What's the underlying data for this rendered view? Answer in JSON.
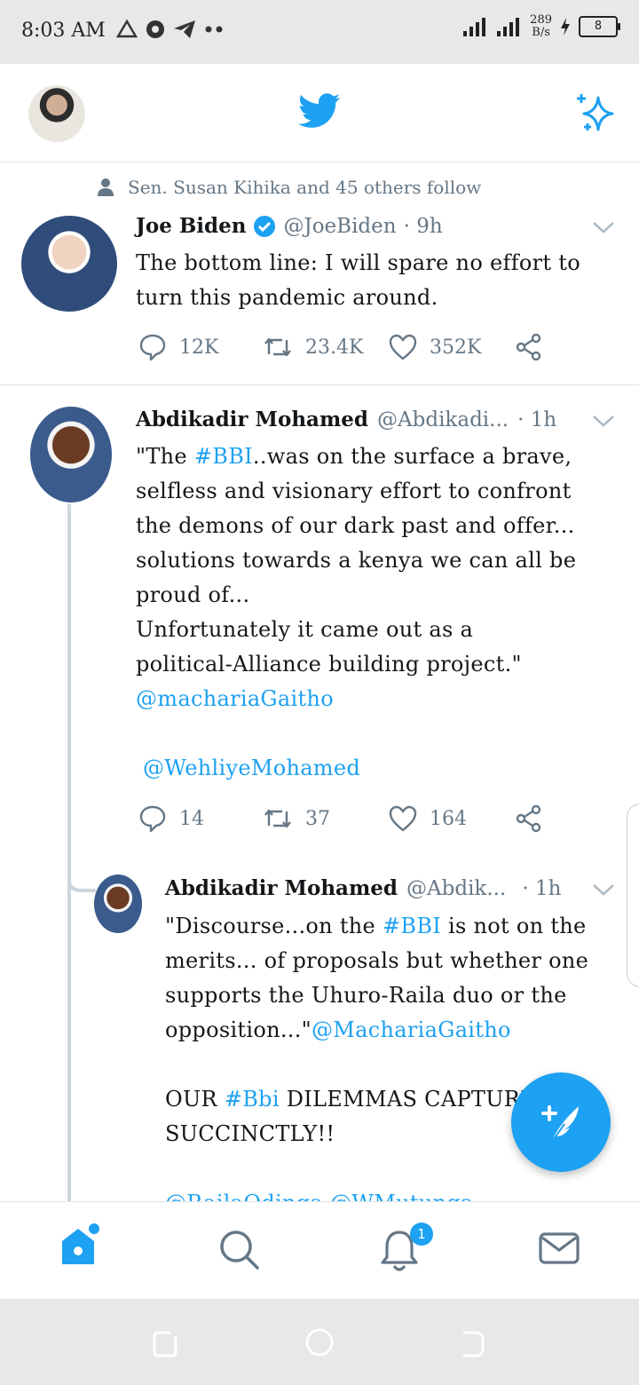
{
  "status_bar": {
    "time": "8:03 AM",
    "speed_value": "289",
    "speed_unit": "B/s",
    "battery": "8"
  },
  "feed": {
    "tweets": [
      {
        "social_context": "Sen. Susan Kihika and 45 others follow",
        "name": "Joe Biden",
        "handle": "@JoeBiden",
        "time": "· 9h",
        "text": "The bottom line: I will spare no effort to turn this pandemic around.",
        "replies": "12K",
        "retweets": "23.4K",
        "likes": "352K"
      },
      {
        "name": "Abdikadir Mohamed",
        "handle": "@Abdikadi...",
        "time": "· 1h",
        "line1_a": "\"The ",
        "line1_tag": "#BBI",
        "line1_b": "..was on the surface a brave,",
        "text_rest": "selfless and visionary effort to confront\nthe demons of our dark past and offer...\nsolutions towards a kenya we can all be\nproud of...\nUnfortunately it came out as a\npolitical-Alliance building project.\"",
        "mention1": "@machariaGaitho",
        "mention2": "@WehliyeMohamed",
        "replies": "14",
        "retweets": "37",
        "likes": "164"
      },
      {
        "name": "Abdikadir Mohamed",
        "handle": "@Abdik...",
        "time": "· 1h",
        "p1_a": "\"Discourse...on the ",
        "p1_tag": "#BBI",
        "p1_b": " is not on the\nmerits... of proposals but whether one\nsupports the Uhuro-Raila duo or the\nopposition...\"",
        "p1_mention": "@MachariaGaitho",
        "p2_a": "OUR ",
        "p2_tag": "#Bbi",
        "p2_b": " DILEMMAS CAPTURED\nSUCCINCTLY!!",
        "p3_mentions": "@RailaOdinga @WMutunga"
      }
    ]
  },
  "bottom_nav": {
    "notifications_badge": "1"
  },
  "colors": {
    "accent": "#1da1f2",
    "secondary_text": "#657786"
  }
}
